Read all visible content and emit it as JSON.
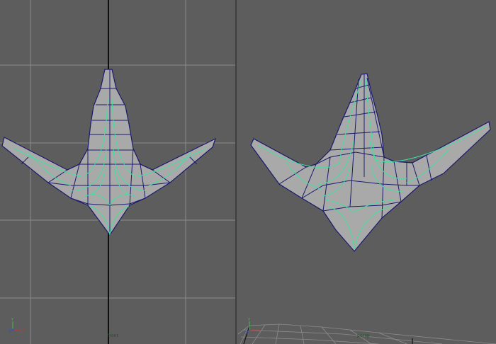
{
  "viewports": {
    "front": {
      "camera_label": "front",
      "axis_labels": {
        "up": "Y",
        "right": "X",
        "forward": "Z"
      }
    },
    "persp": {
      "camera_label": "persp",
      "axis_labels": {
        "up": "Y",
        "right": "X",
        "forward": "Z"
      }
    }
  },
  "colors": {
    "viewport_bg": "#5d5d5d",
    "grid_line": "#8a8a8a",
    "grid_axis": "#111111",
    "mesh_fill": "#a9a9a9",
    "mesh_edge": "#1a1a6e",
    "isoparm": "#40e0a0",
    "axis_x": "#d03030",
    "axis_y": "#40c040",
    "axis_z": "#3050d0"
  }
}
